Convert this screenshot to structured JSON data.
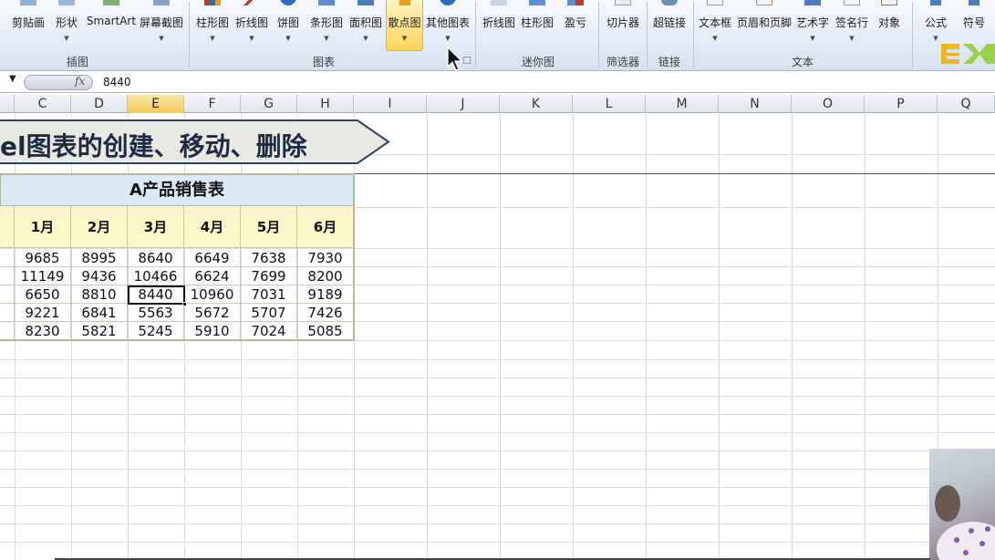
{
  "ribbon": {
    "groups": [
      {
        "label": "插图",
        "buttons": [
          "剪贴画",
          "形状",
          "SmartArt",
          "屏幕截图"
        ]
      },
      {
        "label": "图表",
        "buttons": [
          "柱形图",
          "折线图",
          "饼图",
          "条形图",
          "面积图",
          "散点图",
          "其他图表"
        ]
      },
      {
        "label": "迷你图",
        "buttons": [
          "折线图",
          "柱形图",
          "盈亏"
        ]
      },
      {
        "label": "筛选器",
        "buttons": [
          "切片器"
        ]
      },
      {
        "label": "链接",
        "buttons": [
          "超链接"
        ]
      },
      {
        "label": "文本",
        "buttons": [
          "文本框",
          "页眉和页脚",
          "艺术字",
          "签名行",
          "对象"
        ]
      },
      {
        "label": "",
        "buttons": [
          "公式",
          "符号"
        ]
      }
    ]
  },
  "formula_bar": {
    "fx": "fx",
    "value": "8440"
  },
  "columns": [
    "C",
    "D",
    "E",
    "F",
    "G",
    "H",
    "I",
    "J",
    "K",
    "L",
    "M",
    "N",
    "O",
    "P",
    "Q"
  ],
  "banner": {
    "text": "el图表的创建、移动、删除"
  },
  "table": {
    "title": "A产品销售表",
    "months": [
      "1月",
      "2月",
      "3月",
      "4月",
      "5月",
      "6月"
    ],
    "rows": [
      [
        "9685",
        "8995",
        "8640",
        "6649",
        "7638",
        "7930"
      ],
      [
        "11149",
        "9436",
        "10466",
        "6624",
        "7699",
        "8200"
      ],
      [
        "6650",
        "8810",
        "8440",
        "10960",
        "7031",
        "9189"
      ],
      [
        "9221",
        "6841",
        "5563",
        "5672",
        "5707",
        "7426"
      ],
      [
        "8230",
        "5821",
        "5245",
        "5910",
        "7024",
        "5085"
      ]
    ]
  },
  "colors": {
    "accent": "#f4c956",
    "title_fill": "#dbeaf4",
    "header_fill": "#fdf8cc"
  }
}
